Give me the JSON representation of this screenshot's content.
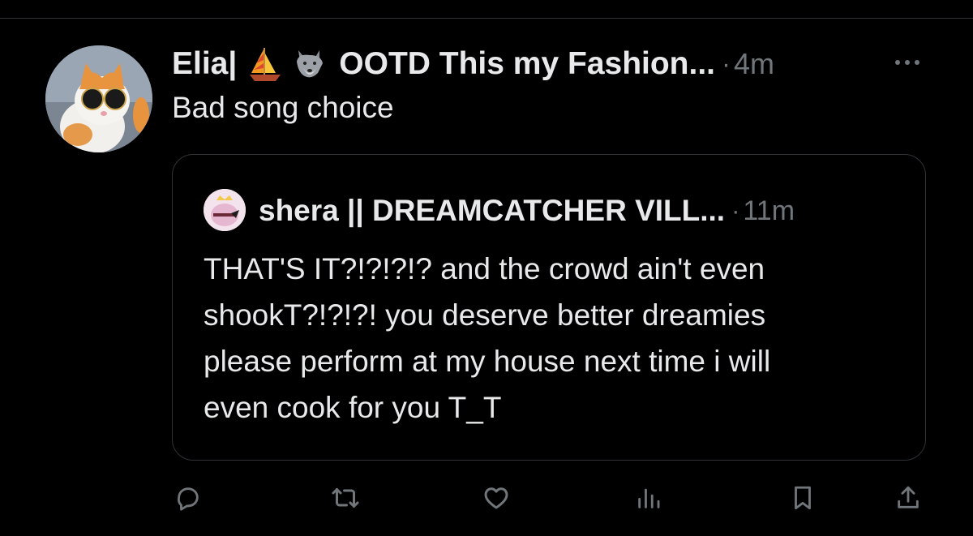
{
  "post": {
    "author_name": "Elia|",
    "author_name_suffix": "OOTD This my Fashion...",
    "separator": "·",
    "time": "4m",
    "text": "Bad song choice",
    "emojis": [
      "sailboat-emoji",
      "wolf-emoji"
    ]
  },
  "quote": {
    "author_name": "shera || DREAMCATCHER VILL...",
    "separator": "·",
    "time": "11m",
    "lines": [
      "THAT'S IT?!?!?!? and the crowd ain't even",
      "shookT?!?!?! you deserve better dreamies",
      "please perform at my house next time i will",
      "even cook for you T_T"
    ]
  },
  "actions": [
    "reply-icon",
    "repost-icon",
    "like-icon",
    "views-icon",
    "bookmark-icon",
    "share-icon"
  ],
  "colors": {
    "background": "#000000",
    "text": "#e7e9ea",
    "muted": "#71767b",
    "border": "#2f3336"
  }
}
